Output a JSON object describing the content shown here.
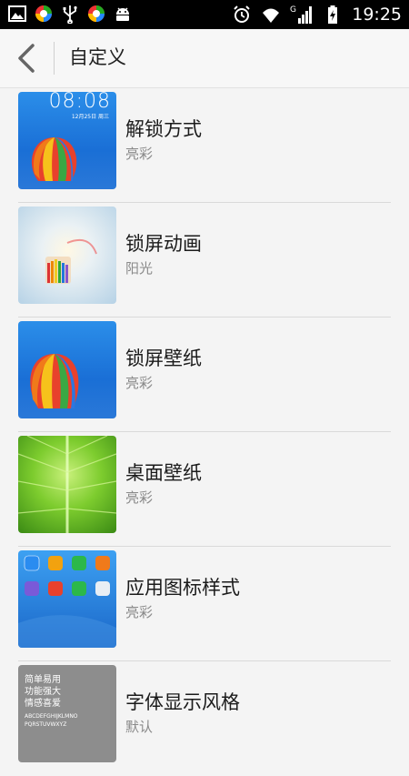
{
  "status_bar": {
    "time": "19:25",
    "network_type": "G"
  },
  "header": {
    "title": "自定义"
  },
  "items": [
    {
      "title": "解锁方式",
      "subtitle": "亮彩",
      "thumb": "balloon-lockscreen"
    },
    {
      "title": "锁屏动画",
      "subtitle": "阳光",
      "thumb": "sunlight"
    },
    {
      "title": "锁屏壁纸",
      "subtitle": "亮彩",
      "thumb": "balloon"
    },
    {
      "title": "桌面壁纸",
      "subtitle": "亮彩",
      "thumb": "green-leaf"
    },
    {
      "title": "应用图标样式",
      "subtitle": "亮彩",
      "thumb": "app-icons"
    },
    {
      "title": "字体显示风格",
      "subtitle": "默认",
      "thumb": "font-sample"
    }
  ],
  "thumb_text": {
    "lock_time": "08:08",
    "lock_date": "12月25日 周三",
    "font_lines": [
      "简单易用",
      "功能强大",
      "情感喜爱"
    ],
    "font_alpha": [
      "ABCDEFGHIJKLMNO",
      "PQRSTUVWXYZ"
    ]
  },
  "colors": {
    "statusbar_bg": "#000000",
    "background": "#f4f4f4",
    "title_text": "#1b1b1b",
    "subtitle_text": "#8a8a8a"
  }
}
